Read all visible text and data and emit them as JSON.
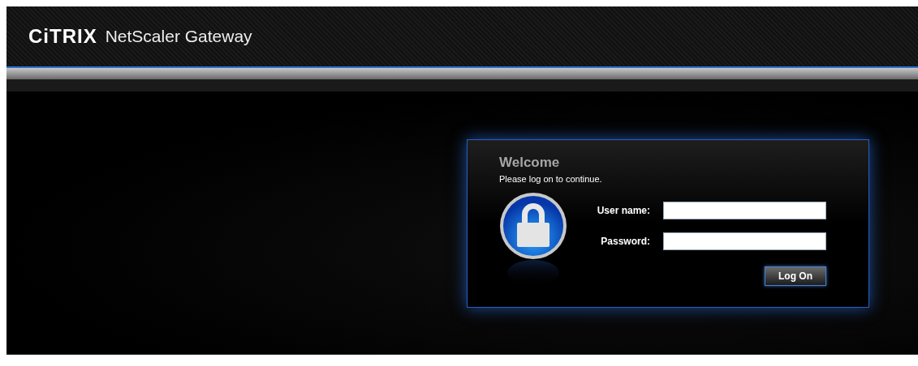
{
  "header": {
    "logo": "CiTRIX",
    "product": "NetScaler Gateway"
  },
  "login": {
    "title": "Welcome",
    "subtitle": "Please log on to continue.",
    "fields": [
      {
        "label": "User name:"
      },
      {
        "label": "Password:"
      }
    ],
    "button": "Log On"
  }
}
